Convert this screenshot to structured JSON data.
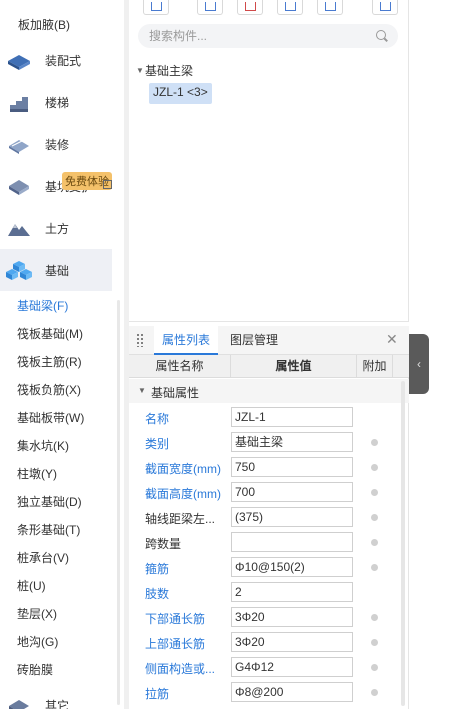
{
  "nav": {
    "top_items": [
      "板加腋(B)"
    ],
    "categories": [
      {
        "label": "装配式",
        "icon": "prefab-icon"
      },
      {
        "label": "楼梯",
        "icon": "stairs-icon"
      },
      {
        "label": "装修",
        "icon": "decoration-icon"
      },
      {
        "label": "基坑支护",
        "icon": "foundation-pit-icon"
      },
      {
        "label": "土方",
        "icon": "earthwork-icon"
      },
      {
        "label": "基础",
        "icon": "foundation-icon",
        "active": true
      }
    ],
    "badge": "免费体验",
    "sub_items": [
      {
        "label": "基础梁(F)",
        "active": true
      },
      {
        "label": "筏板基础(M)"
      },
      {
        "label": "筏板主筋(R)"
      },
      {
        "label": "筏板负筋(X)"
      },
      {
        "label": "基础板带(W)"
      },
      {
        "label": "集水坑(K)"
      },
      {
        "label": "柱墩(Y)"
      },
      {
        "label": "独立基础(D)"
      },
      {
        "label": "条形基础(T)"
      },
      {
        "label": "桩承台(V)"
      },
      {
        "label": "桩(U)"
      },
      {
        "label": "垫层(X)"
      },
      {
        "label": "地沟(G)"
      },
      {
        "label": "砖胎膜"
      }
    ],
    "bottom_category": {
      "label": "其它",
      "icon": "other-icon"
    }
  },
  "component_panel": {
    "search_placeholder": "搜索构件...",
    "tree_group": "基础主梁",
    "tree_item": "JZL-1 <3>"
  },
  "property_panel": {
    "tabs": [
      {
        "label": "属性列表",
        "active": true
      },
      {
        "label": "图层管理"
      }
    ],
    "columns": [
      "属性名称",
      "属性值",
      "附加"
    ],
    "group": "基础属性",
    "rows": [
      {
        "name": "名称",
        "value": "JZL-1",
        "color": "blue",
        "extra": false
      },
      {
        "name": "类别",
        "value": "基础主梁",
        "color": "blue",
        "extra": true
      },
      {
        "name": "截面宽度(mm)",
        "value": "750",
        "color": "blue",
        "extra": true
      },
      {
        "name": "截面高度(mm)",
        "value": "700",
        "color": "blue",
        "extra": true
      },
      {
        "name": "轴线距梁左...",
        "value": "(375)",
        "color": "black",
        "extra": true
      },
      {
        "name": "跨数量",
        "value": "",
        "color": "black",
        "extra": true
      },
      {
        "name": "箍筋",
        "value": "Φ10@150(2)",
        "color": "blue",
        "extra": true
      },
      {
        "name": "肢数",
        "value": "2",
        "color": "blue",
        "extra": false
      },
      {
        "name": "下部通长筋",
        "value": "3Φ20",
        "color": "blue",
        "extra": true
      },
      {
        "name": "上部通长筋",
        "value": "3Φ20",
        "color": "blue",
        "extra": true
      },
      {
        "name": "侧面构造或...",
        "value": "G4Φ12",
        "color": "blue",
        "extra": true
      },
      {
        "name": "拉筋",
        "value": "Φ8@200",
        "color": "blue",
        "extra": true
      }
    ]
  },
  "colors": {
    "accent": "#2a79d9",
    "active_bg": "#eef0f5",
    "badge": "#f4c16a"
  }
}
